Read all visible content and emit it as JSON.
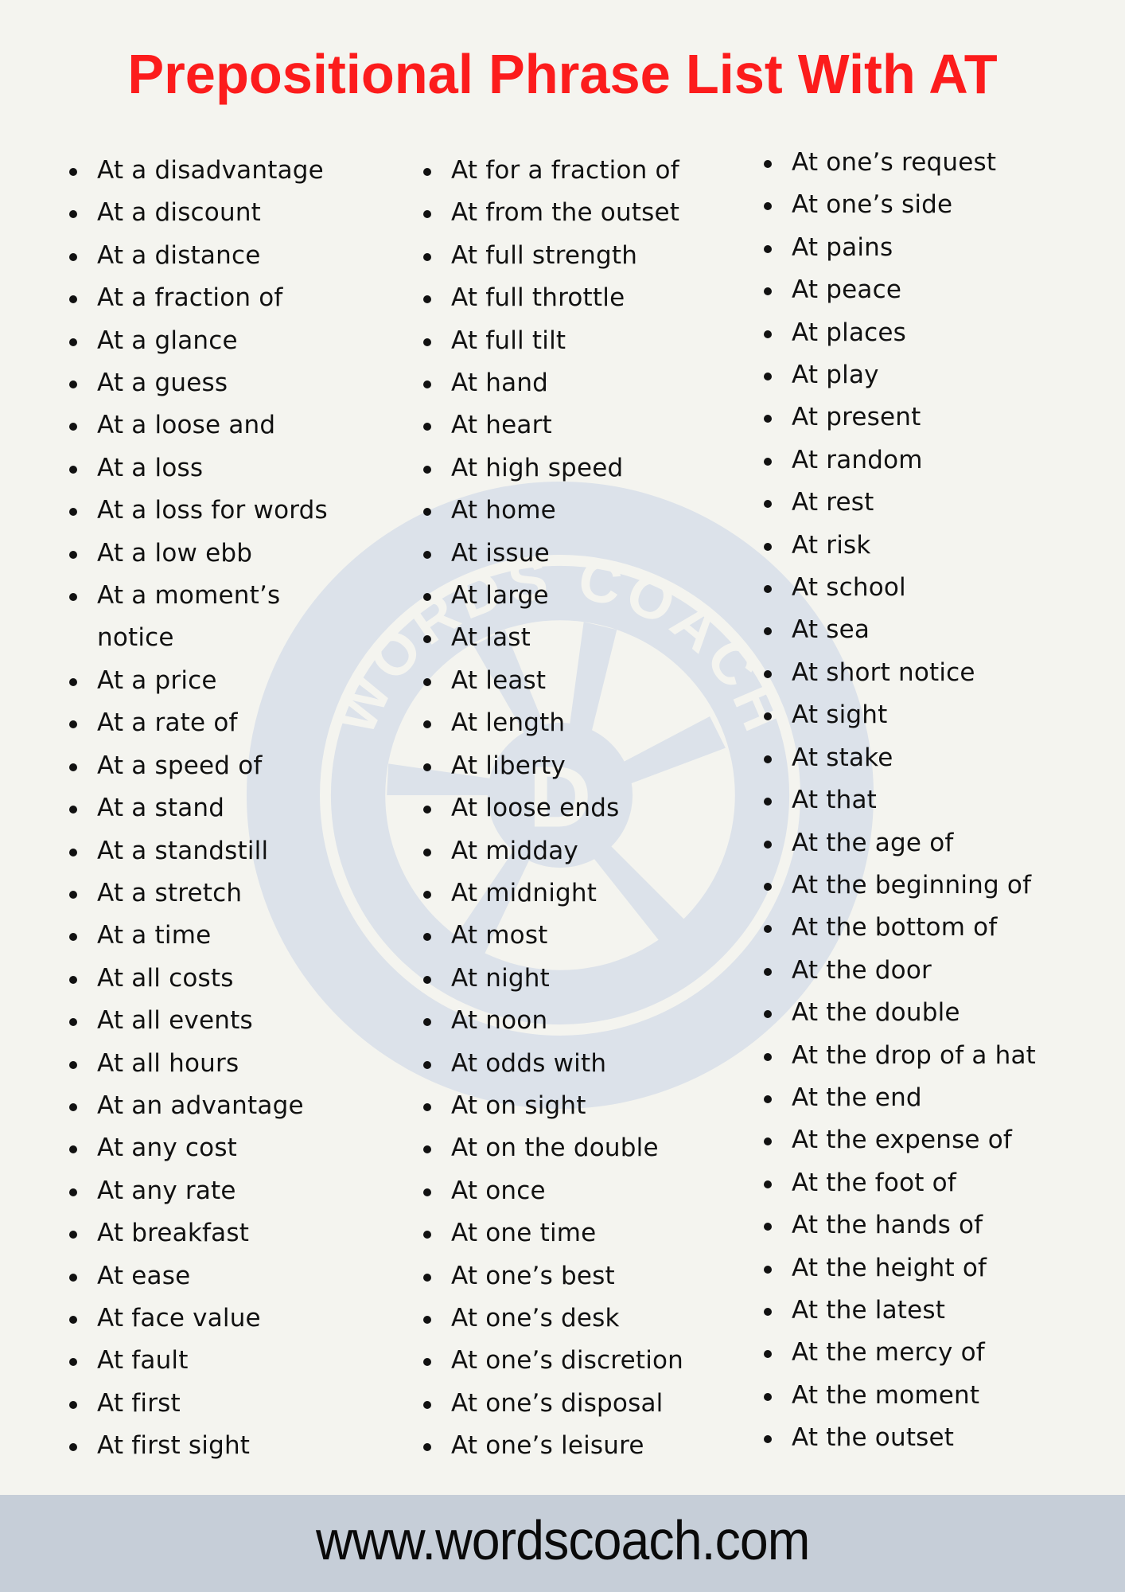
{
  "header": {
    "title": "Prepositional Phrase List With AT"
  },
  "watermark": {
    "brand_text": "WORDS COACH",
    "logo_letter": "D",
    "icon": "camera-aperture-logo-icon",
    "color": "#dce2ea"
  },
  "colors": {
    "title": "#fc1c1c",
    "background": "#f4f4ef",
    "footer_band": "#c6ced8",
    "text": "#111111"
  },
  "columns": [
    {
      "items": [
        "At a disadvantage",
        "At a discount",
        "At a distance",
        "At a fraction of",
        "At a glance",
        "At a guess",
        "At a loose and",
        "At a loss",
        "At a loss for words",
        "At a low ebb",
        "At a moment’s notice",
        "At a price",
        "At a rate of",
        "At a speed of",
        "At a stand",
        "At a standstill",
        "At a stretch",
        "At a time",
        "At all costs",
        "At all events",
        "At all hours",
        "At an advantage",
        "At any cost",
        "At any rate",
        "At breakfast",
        "At ease",
        "At face value",
        "At fault",
        "At first",
        "At first sight"
      ]
    },
    {
      "items": [
        "At for a fraction of",
        "At from the outset",
        "At full strength",
        "At full throttle",
        "At full tilt",
        "At hand",
        "At heart",
        "At high speed",
        "At home",
        "At issue",
        "At large",
        "At last",
        "At least",
        "At length",
        "At liberty",
        "At loose ends",
        "At midday",
        "At midnight",
        "At most",
        "At night",
        "At noon",
        "At odds with",
        "At on sight",
        "At on the double",
        "At once",
        "At one time",
        "At one’s best",
        "At one’s desk",
        "At one’s discretion",
        "At one’s disposal",
        "At one’s leisure"
      ]
    },
    {
      "items": [
        "At one’s request",
        "At one’s side",
        "At pains",
        "At peace",
        "At places",
        "At play",
        "At present",
        "At random",
        "At rest",
        "At risk",
        "At school",
        "At sea",
        "At short notice",
        "At sight",
        "At stake",
        "At that",
        "At the age of",
        "At the beginning of",
        "At the bottom of",
        "At the door",
        "At the double",
        "At the drop of a hat",
        "At the end",
        "At the expense of",
        "At the foot of",
        "At the hands of",
        "At the height of",
        "At the latest",
        "At the mercy of",
        "At the moment",
        "At the outset"
      ]
    }
  ],
  "footer": {
    "url": "www.wordscoach.com"
  }
}
